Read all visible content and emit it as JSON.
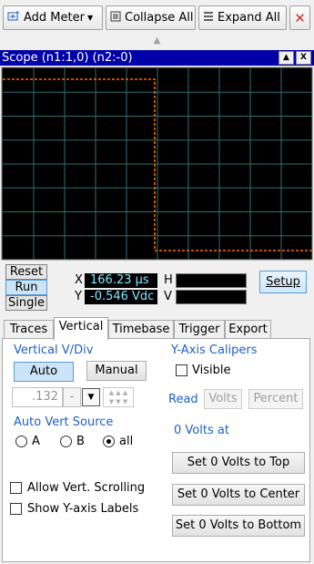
{
  "toolbar": {
    "add_meter": "Add Meter",
    "collapse_all": "Collapse All",
    "expand_all": "Expand All",
    "collapse_arrow": "▲"
  },
  "scope": {
    "title": "Scope (n1:1,0) (n2:-0)",
    "minimize_glyph": "▲",
    "close_glyph": "X",
    "trace_color": "#ff6a00",
    "grid_color": "#2e6f72",
    "background": "#000000"
  },
  "readout": {
    "reset": "Reset",
    "run": "Run",
    "single": "Single",
    "x_label": "X",
    "x_value": "166.23 µs",
    "y_label": "Y",
    "y_value": "-0.546 Vdc",
    "h_label": "H",
    "v_label": "V",
    "setup": "Setup"
  },
  "tabs": [
    {
      "label": "Traces",
      "active": false
    },
    {
      "label": "Vertical",
      "active": true
    },
    {
      "label": "Timebase",
      "active": false
    },
    {
      "label": "Trigger",
      "active": false
    },
    {
      "label": "Export",
      "active": false
    }
  ],
  "vertical": {
    "vdiv_title": "Vertical V/Div",
    "auto": "Auto",
    "manual": "Manual",
    "vdiv_value": ".132",
    "vdiv_dash": "-",
    "auto_source_title": "Auto Vert Source",
    "source_a": "A",
    "source_b": "B",
    "source_all": "all",
    "selected_source": "all",
    "allow_scrolling": "Allow Vert. Scrolling",
    "show_labels": "Show Y-axis Labels"
  },
  "calipers": {
    "title": "Y-Axis Calipers",
    "visible": "Visible",
    "read": "Read",
    "volts": "Volts",
    "percent": "Percent",
    "zero_title": "0 Volts at",
    "to_top": "Set 0 Volts to Top",
    "to_center": "Set 0 Volts to Center",
    "to_bottom": "Set 0 Volts to Bottom"
  }
}
